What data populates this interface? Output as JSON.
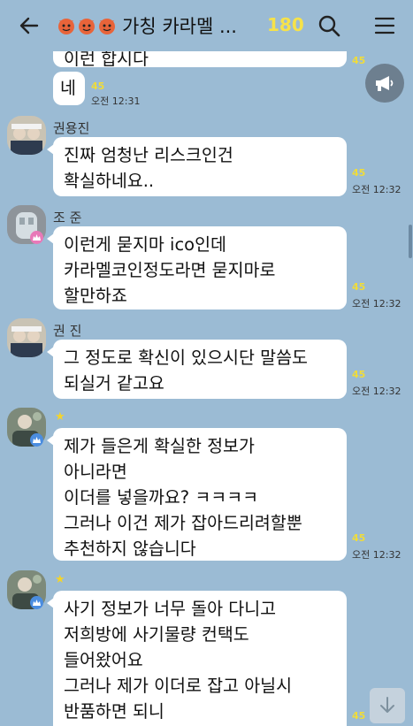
{
  "header": {
    "title": "가칭 카라멜 ...",
    "member_count": "180"
  },
  "messages": [
    {
      "id": "m0",
      "text_partial": "이런 합시다",
      "unread": "45"
    },
    {
      "id": "m1",
      "text": "네",
      "unread": "45",
      "time": "오전 12:31"
    },
    {
      "id": "m2",
      "sender": "권용진",
      "lines": [
        "진짜 엄청난 리스크인건",
        "확실하네요.."
      ],
      "unread": "45",
      "time": "오전 12:32"
    },
    {
      "id": "m3",
      "sender": "조 준",
      "lines": [
        "이런게 묻지마 ico인데",
        "카라멜코인정도라면 묻지마로",
        "할만하죠"
      ],
      "unread": "45",
      "time": "오전 12:32"
    },
    {
      "id": "m4",
      "sender": "권 진",
      "lines": [
        "그 정도로 확신이 있으시단 말씀도",
        "되실거 같고요"
      ],
      "unread": "45",
      "time": "오전 12:32"
    },
    {
      "id": "m5",
      "sender": "★",
      "lines": [
        "제가 들은게 확실한 정보가",
        "아니라면",
        "이더를 넣을까요? ㅋㅋㅋㅋ",
        "그러나 이건 제가 잡아드리려할뿐",
        "추천하지 않습니다"
      ],
      "unread": "45",
      "time": "오전 12:32"
    },
    {
      "id": "m6",
      "sender": "★",
      "lines": [
        "사기 정보가 너무 돌아 다니고",
        "저희방에 사기물량 컨택도",
        "들어왔어요",
        "그러나 제가 이더로 잡고 아닐시",
        "반품하면 되니"
      ],
      "unread": "45"
    }
  ],
  "icons": {
    "back": "arrow-left-icon",
    "search": "search-icon",
    "menu": "hamburger-menu-icon",
    "announce": "megaphone-icon",
    "scroll_down": "arrow-down-icon"
  },
  "colors": {
    "background": "#9bbbd4",
    "unread": "#f0dc3a",
    "count": "#f6e24a"
  }
}
